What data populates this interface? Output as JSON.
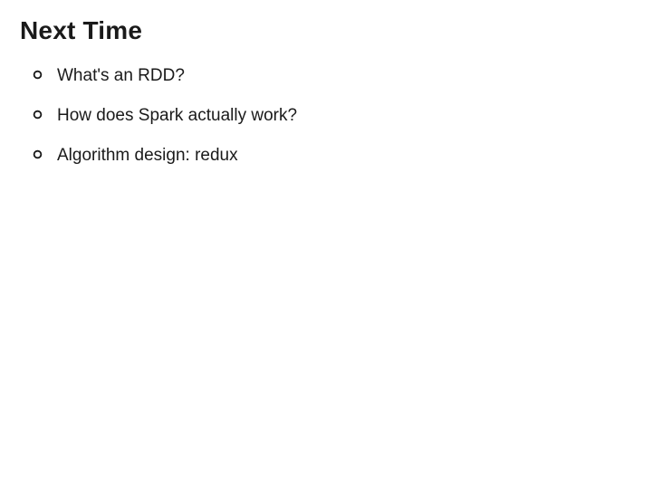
{
  "title": "Next Time",
  "bullets": [
    {
      "text": "What's an RDD?"
    },
    {
      "text": "How does Spark actually work?"
    },
    {
      "text": "Algorithm design: redux"
    }
  ]
}
